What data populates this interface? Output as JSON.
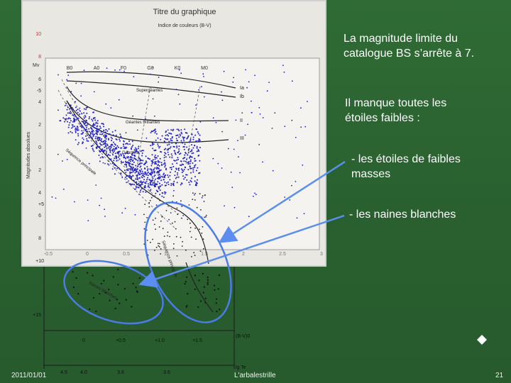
{
  "figure": {
    "title": "Titre du graphique",
    "top_axis_label": "Indice de couleurs (B-V)",
    "y_axis_label": "Magnitudes absolues",
    "mv_label": "Mv",
    "left_ticks": [
      "10",
      "8",
      "6",
      "4",
      "2",
      "0",
      "2",
      "4",
      "6",
      "8"
    ],
    "left_signs": [
      "-5",
      "+5",
      "+10",
      "+15"
    ],
    "bottom_ticks": [
      "-0.5",
      "0",
      "0.5",
      "1",
      "1.5",
      "2",
      "2.5",
      "3"
    ],
    "lower_bv_ticks": [
      "0",
      "+0.5",
      "+1.0",
      "+1.5"
    ],
    "lower_bv_label": "(B-V)0",
    "temp_ticks": [
      "4.5",
      "4.0",
      "3.8",
      "3.6"
    ],
    "temp_label": "lg Te",
    "spectral_types": [
      "B0",
      "A0",
      "F0",
      "G0",
      "K0",
      "M0"
    ],
    "luminosity_classes": [
      "Ia",
      "Ib",
      "II",
      "III"
    ],
    "region_labels": {
      "supergiants": "Supergéantes",
      "bright_giants": "Géantes brillantes",
      "giants": "Géantes",
      "main_sequence": "Séquence principale",
      "white_dwarfs": "Naines blanches"
    }
  },
  "text": {
    "p1_line1": "La magnitude limite du",
    "p1_line2": "catalogue BS s’arrête à 7.",
    "p2_line1": "Il manque toutes les",
    "p2_line2": "étoiles faibles  :",
    "bullet1_line1": "- les étoiles de faibles",
    "bullet1_line2": "masses",
    "bullet2": "- les naines blanches"
  },
  "footer": {
    "date": "2011/01/01",
    "author": "L'arbalestrille",
    "page": "21"
  },
  "colors": {
    "background": "#2a6030",
    "stars": "#2020c8",
    "highlight": "#4a7be8",
    "arrow": "#5b8ef0"
  }
}
